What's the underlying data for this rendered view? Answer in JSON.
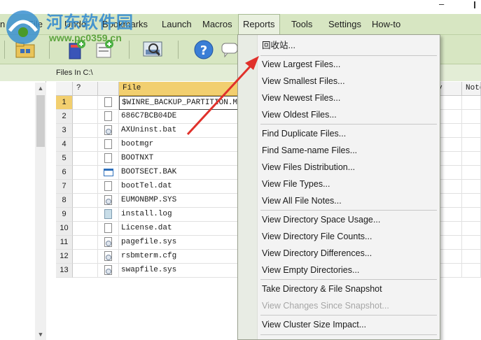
{
  "watermark": {
    "site_name": "河东软件园",
    "site_url": "www.pc0359.cn"
  },
  "menubar": {
    "items": [
      {
        "label": "n"
      },
      {
        "label": "File"
      },
      {
        "label": "Undo"
      },
      {
        "label": "Bookmarks"
      },
      {
        "label": "Launch"
      },
      {
        "label": "Macros"
      },
      {
        "label": "Reports"
      },
      {
        "label": "Tools"
      },
      {
        "label": "Settings"
      },
      {
        "label": "How-to"
      }
    ],
    "active": "Reports"
  },
  "toolbar": {
    "buttons": [
      "open-folder-icon",
      "bookmark-add-icon",
      "edit-note-icon",
      "zoom-magnifier-icon",
      "help-icon",
      "chat-icon"
    ]
  },
  "path": {
    "label": "Files In C:\\"
  },
  "grid": {
    "columns": {
      "question": "?",
      "file": "File",
      "col_y": "y",
      "notes": "Note"
    },
    "rows": [
      {
        "n": "1",
        "name": "$WINRE_BACKUP_PARTITION.MARK",
        "icon": "blank-file-icon"
      },
      {
        "n": "2",
        "name": "686C7BCB04DE",
        "icon": "blank-file-icon"
      },
      {
        "n": "3",
        "name": "AXUninst.bat",
        "icon": "gear-file-icon"
      },
      {
        "n": "4",
        "name": "bootmgr",
        "icon": "blank-file-icon"
      },
      {
        "n": "5",
        "name": "BOOTNXT",
        "icon": "blank-file-icon"
      },
      {
        "n": "6",
        "name": "BOOTSECT.BAK",
        "icon": "window-file-icon"
      },
      {
        "n": "7",
        "name": "bootTel.dat",
        "icon": "blank-file-icon"
      },
      {
        "n": "8",
        "name": "EUMONBMP.SYS",
        "icon": "gear-file-icon"
      },
      {
        "n": "9",
        "name": "install.log",
        "icon": "log-file-icon"
      },
      {
        "n": "10",
        "name": "License.dat",
        "icon": "blank-file-icon"
      },
      {
        "n": "11",
        "name": "pagefile.sys",
        "icon": "gear-file-icon"
      },
      {
        "n": "12",
        "name": "rsbmterm.cfg",
        "icon": "gear-file-icon"
      },
      {
        "n": "13",
        "name": "swapfile.sys",
        "icon": "gear-file-icon"
      }
    ]
  },
  "reports_menu": {
    "items": [
      {
        "label": "回收站..."
      },
      {
        "label": "View Largest Files..."
      },
      {
        "label": "View Smallest Files..."
      },
      {
        "label": "View Newest Files..."
      },
      {
        "label": "View Oldest Files..."
      },
      {
        "label": "Find Duplicate Files..."
      },
      {
        "label": "Find Same-name Files..."
      },
      {
        "label": "View Files Distribution..."
      },
      {
        "label": "View File Types..."
      },
      {
        "label": "View All File Notes..."
      },
      {
        "label": "View Directory Space Usage..."
      },
      {
        "label": "View Directory File Counts..."
      },
      {
        "label": "View Directory Differences..."
      },
      {
        "label": "View Empty Directories..."
      },
      {
        "label": "Take Directory & File Snapshot"
      },
      {
        "label": "View Changes Since Snapshot...",
        "disabled": true
      },
      {
        "label": "View Cluster Size Impact..."
      }
    ]
  },
  "colors": {
    "menubar_bg": "#d7e6c2",
    "selection_header": "#f2cf6f",
    "arrow": "#e0312b",
    "watermark_blue": "#3a8fd0",
    "watermark_green": "#4a9a2a"
  }
}
